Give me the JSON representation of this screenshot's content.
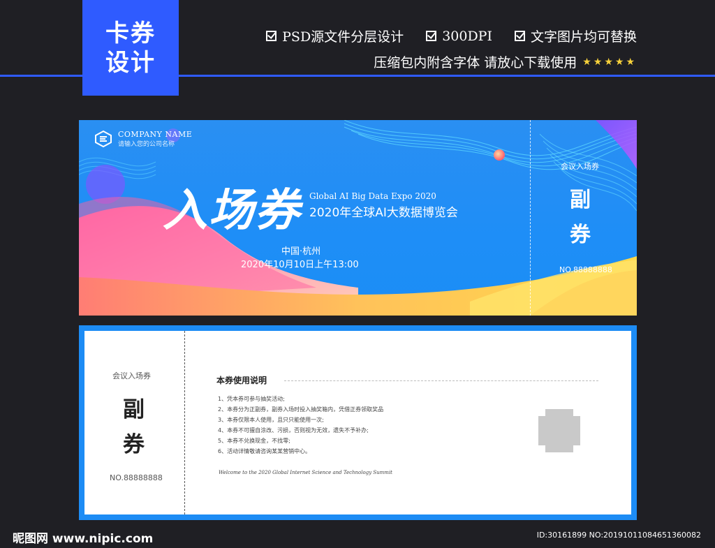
{
  "badge": {
    "line1": "卡券",
    "line2": "设计"
  },
  "features": {
    "item1": "PSD源文件分层设计",
    "item2": "300DPI",
    "item3": "文字图片均可替换",
    "line2": "压缩包内附含字体 请放心下载使用",
    "stars": "★★★★★",
    "check_icon": "checkbox-icon"
  },
  "front": {
    "company_name": "COMPANY NAME",
    "company_sub": "请输入您的公司名称",
    "title": "入场券",
    "expo_en": "Global AI Big Data Expo 2020",
    "expo_cn": "2020年全球AI大数据博览会",
    "location": "中国·杭州",
    "datetime": "2020年10月10日上午13:00",
    "stub_label": "会议入场券",
    "stub_fu1": "副",
    "stub_fu2": "券",
    "stub_no": "NO.88888888"
  },
  "back": {
    "stub_label": "会议入场券",
    "stub_fu1": "副",
    "stub_fu2": "券",
    "stub_no": "NO.88888888",
    "instructions_title": "本券使用说明",
    "instructions": [
      "1、凭本券可参与抽奖活动;",
      "2、本券分为正副券，副券入场时投入抽奖箱内，凭借正券领取奖品",
      "3、本券仅限本人使用，且只只能使用一次;",
      "4、本券不可擅自涂改、污损，否则视为无效，遗失不予补办;",
      "5、本券不兑换现金，不找零;",
      "6、活动详情敬请咨询某某营销中心。"
    ],
    "english_line": "Welcome to the 2020 Global Internet Science and Technology Summit"
  },
  "watermark": {
    "left": "昵图网 www.nipic.com",
    "right": "ID:30161899 NO:20191011084651360082"
  }
}
